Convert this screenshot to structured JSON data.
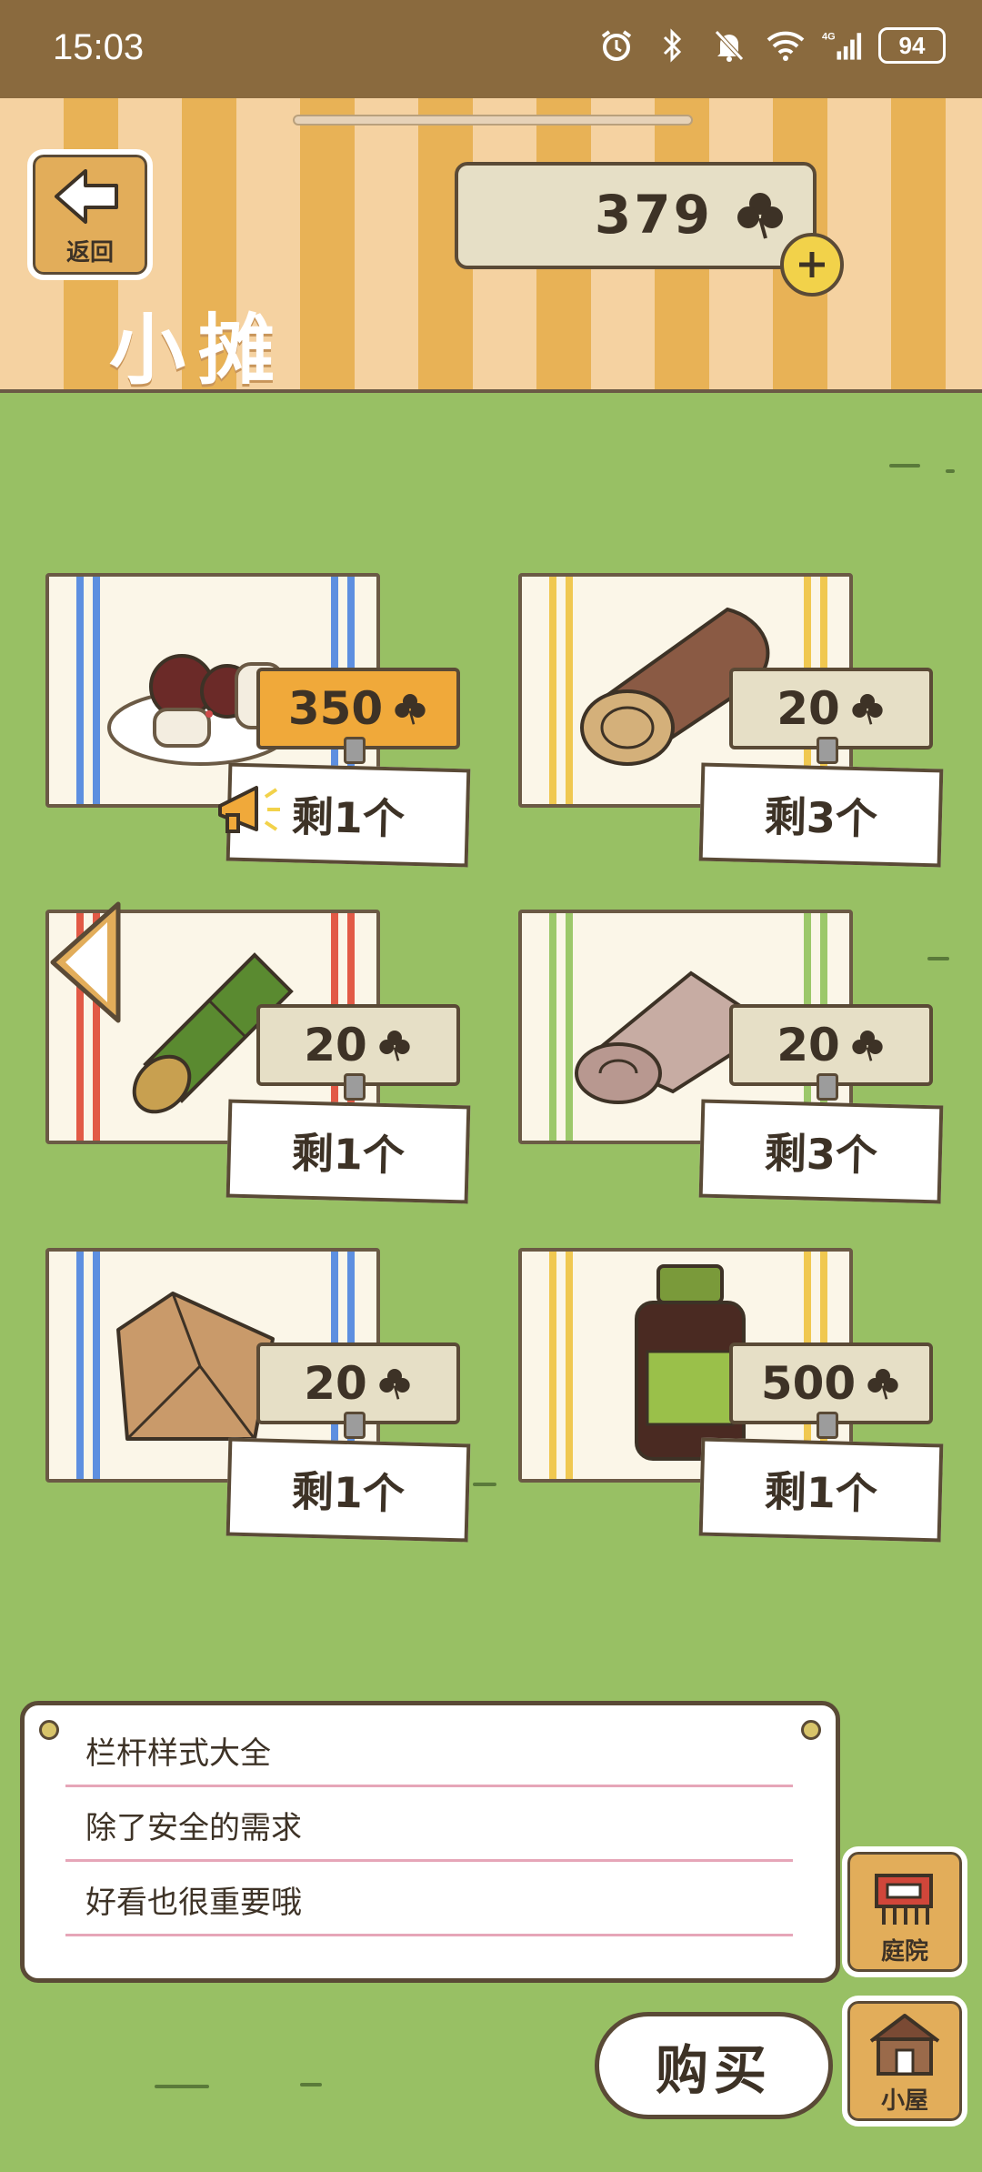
{
  "status_bar": {
    "time": "15:03",
    "battery": "94"
  },
  "header": {
    "back_label": "返回",
    "coins": "379",
    "title": "小摊"
  },
  "items": [
    {
      "price": "350",
      "stock": "剩1个",
      "highlight": true
    },
    {
      "price": "20",
      "stock": "剩3个",
      "highlight": false
    },
    {
      "price": "20",
      "stock": "剩1个",
      "highlight": false
    },
    {
      "price": "20",
      "stock": "剩3个",
      "highlight": false
    },
    {
      "price": "20",
      "stock": "剩1个",
      "highlight": false
    },
    {
      "price": "500",
      "stock": "剩1个",
      "highlight": false
    }
  ],
  "description": {
    "lines": [
      "栏杆样式大全",
      "除了安全的需求",
      "好看也很重要哦"
    ]
  },
  "side_buttons": {
    "yard": "庭院",
    "house": "小屋"
  },
  "buy_label": "购买",
  "colors": {
    "accent": "#f0a93a",
    "grass": "#98c064",
    "wood": "#e2ad5a"
  }
}
